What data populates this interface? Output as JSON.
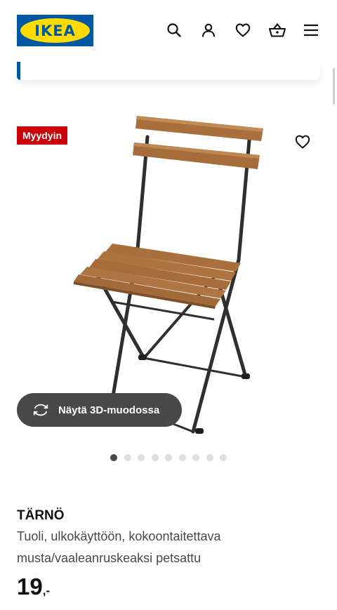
{
  "header": {
    "logo_text": "IKEA",
    "icons": [
      "search-icon",
      "user-icon",
      "heart-icon",
      "basket-icon",
      "menu-icon"
    ]
  },
  "product": {
    "badge": "Myydyin",
    "view_3d_label": "Näytä 3D-muodossa",
    "image_count": 9,
    "active_image": 1,
    "name": "TÄRNÖ",
    "description_line1": "Tuoli, ulkokäyttöön, kokoontaitettava",
    "description_line2": "musta/vaaleanruskeaksi petsattu",
    "price_integer": "19",
    "price_suffix": ",-"
  },
  "colors": {
    "brand_blue": "#0058a3",
    "brand_yellow": "#ffdb00",
    "badge_red": "#cc0008",
    "button_dark": "#484848"
  }
}
